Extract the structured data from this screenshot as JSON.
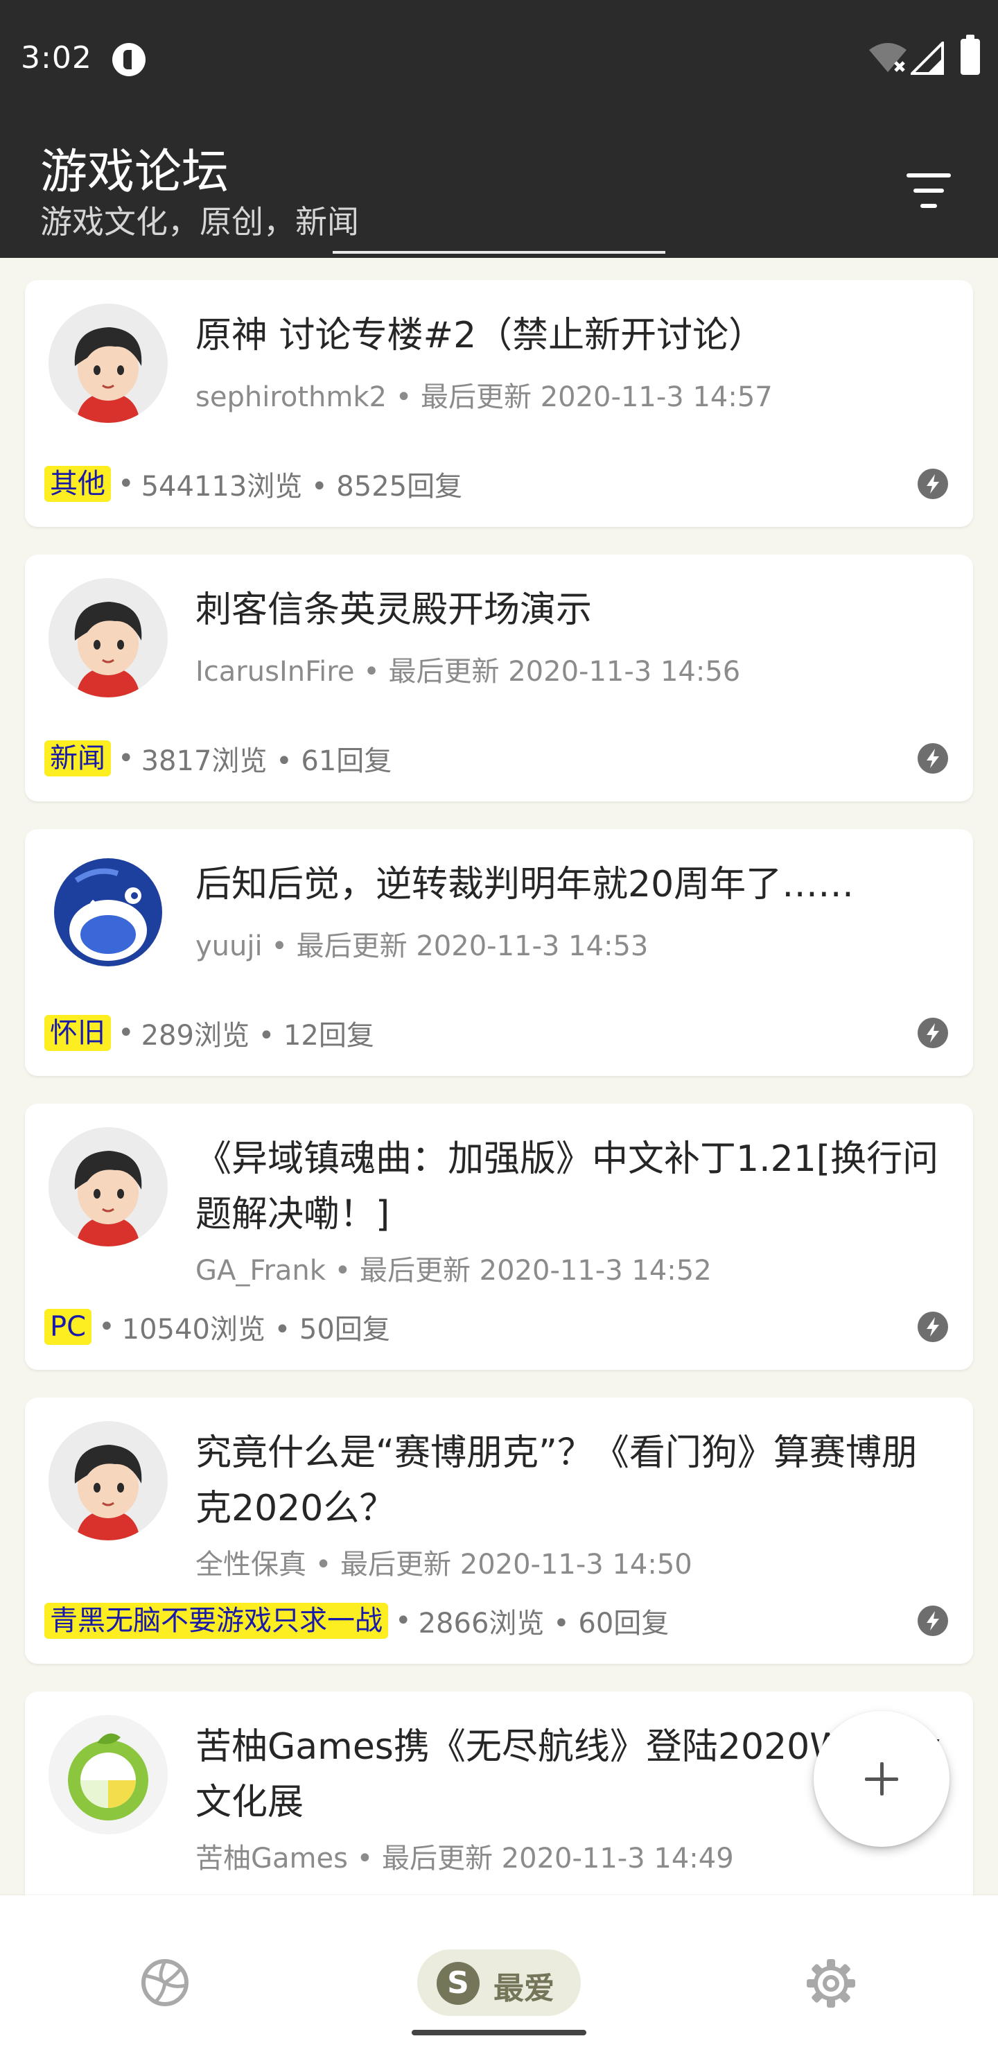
{
  "status_bar": {
    "time": "3:02"
  },
  "app_bar": {
    "title": "游戏论坛",
    "subtitle": "游戏文化，原创，新闻",
    "filter_icon": "filter-icon"
  },
  "posts": [
    {
      "title": "原神 讨论专楼#2（禁止新开讨论）",
      "author": "sephirothmk2",
      "updated": "最后更新 2020-11-3 14:57",
      "tag": "其他",
      "stats": "544113浏览 • 8525回复",
      "avatar": "cartoon-boy"
    },
    {
      "title": "刺客信条英灵殿开场演示",
      "author": "IcarusInFire",
      "updated": "最后更新 2020-11-3 14:56",
      "tag": "新闻",
      "stats": "3817浏览 • 61回复",
      "avatar": "cartoon-boy"
    },
    {
      "title": "后知后觉，逆转裁判明年就20周年了……",
      "author": "yuuji",
      "updated": "最后更新 2020-11-3 14:53",
      "tag": "怀旧",
      "stats": "289浏览 • 12回复",
      "avatar": "blue-penguin"
    },
    {
      "title": "《异域镇魂曲：加强版》中文补丁1.21[换行问题解决嘞！]",
      "author": "GA_Frank",
      "updated": "最后更新 2020-11-3 14:52",
      "tag": "PC",
      "stats": "10540浏览 • 50回复",
      "avatar": "cartoon-boy"
    },
    {
      "title": "究竟什么是“赛博朋克”？《看门狗》算赛博朋克2020么？",
      "author": "全性保真",
      "updated": "最后更新 2020-11-3 14:50",
      "tag": "青黑无脑不要游戏只求一战",
      "stats": "2866浏览 • 60回复",
      "avatar": "cartoon-boy"
    },
    {
      "title": "苦柚Games携《无尽航线》登陆2020WePlay文化展",
      "author": "苦柚Games",
      "updated": "最后更新 2020-11-3 14:49",
      "avatar": "lime-logo"
    }
  ],
  "separator": "•",
  "fab": {
    "icon": "plus-icon"
  },
  "bottom_nav": {
    "items": [
      {
        "icon": "volleyball-icon",
        "label": ""
      },
      {
        "icon": "s-badge-icon",
        "badge": "S",
        "label": "最爱",
        "active": true
      },
      {
        "icon": "gear-icon",
        "label": ""
      }
    ]
  },
  "colors": {
    "app_bar": "#2b2b2b",
    "background": "#f6f6ee",
    "tag_bg": "#fcee21",
    "tag_text": "#1a1aa8",
    "nav_active": "#75755a"
  }
}
